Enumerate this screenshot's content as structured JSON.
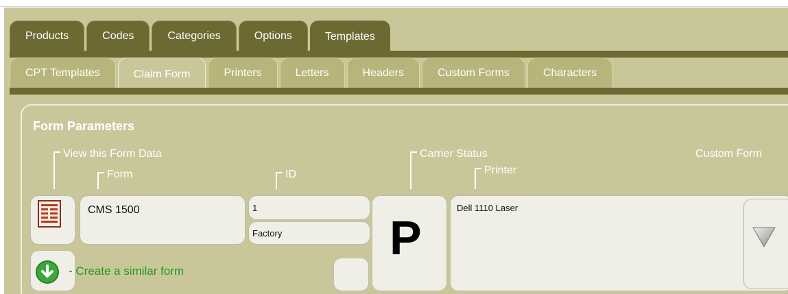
{
  "tabs_main": [
    {
      "label": "Products"
    },
    {
      "label": "Codes"
    },
    {
      "label": "Categories"
    },
    {
      "label": "Options"
    },
    {
      "label": "Templates",
      "active": true
    }
  ],
  "tabs_sub": [
    {
      "label": "CPT Templates"
    },
    {
      "label": "Claim Form",
      "active": true
    },
    {
      "label": "Printers"
    },
    {
      "label": "Letters"
    },
    {
      "label": "Headers"
    },
    {
      "label": "Custom Forms"
    },
    {
      "label": "Characters"
    }
  ],
  "panel": {
    "title": "Form Parameters",
    "labels": {
      "view_form_data": "View this Form Data",
      "form": "Form",
      "id": "ID",
      "carrier_status": "Carrier Status",
      "printer": "Printer",
      "custom_form": "Custom Form"
    },
    "form_name": "CMS 1500",
    "id_value": "1",
    "id_source": "Factory",
    "carrier_status_value": "P",
    "printer_value": "Dell 1110 Laser",
    "create_similar": "- Create a similar form"
  },
  "colors": {
    "frame": "#c9c79a",
    "dark_tab": "#6c6a32",
    "light_tab": "#b8b57c",
    "link_green": "#1f9a1f"
  },
  "icons": {
    "form": "form-document-icon",
    "create": "down-arrow-circle-icon",
    "dropdown": "triangle-down-icon"
  }
}
